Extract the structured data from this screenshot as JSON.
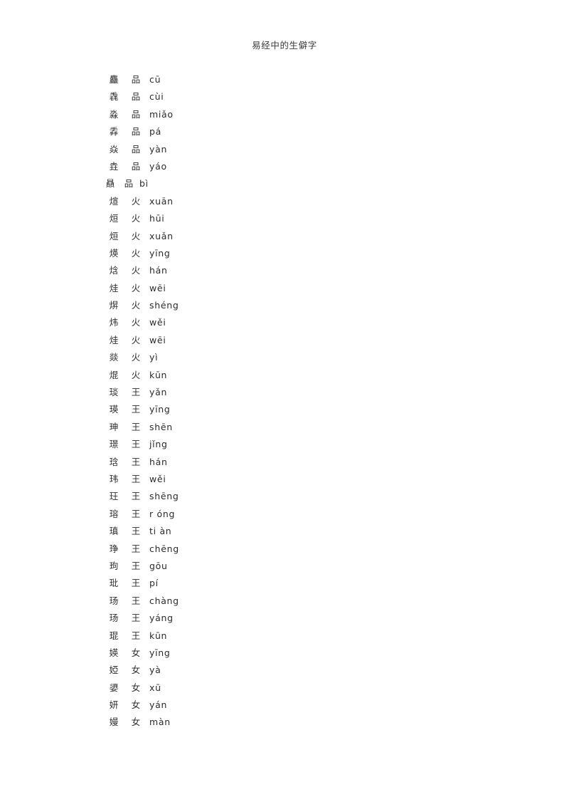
{
  "document": {
    "title": "易经中的生僻字"
  },
  "entries": [
    {
      "character": "麤",
      "radical": "品",
      "pinyin": "cū",
      "compact": false
    },
    {
      "character": "毳",
      "radical": "品",
      "pinyin": "cùi",
      "compact": false
    },
    {
      "character": "淼",
      "radical": "品",
      "pinyin": "miǎo",
      "compact": false
    },
    {
      "character": "掱",
      "radical": "品",
      "pinyin": "pá",
      "compact": false
    },
    {
      "character": "焱",
      "radical": "品",
      "pinyin": "yàn",
      "compact": false
    },
    {
      "character": "垚",
      "radical": "品",
      "pinyin": "yáo",
      "compact": false
    },
    {
      "character": "贔",
      "radical": "品",
      "pinyin": "bì",
      "compact": true
    },
    {
      "character": "煊",
      "radical": "火",
      "pinyin": "xuān",
      "compact": false
    },
    {
      "character": "烜",
      "radical": "火",
      "pinyin": "hūi",
      "compact": false
    },
    {
      "character": "烜",
      "radical": "火",
      "pinyin": "xuǎn",
      "compact": false
    },
    {
      "character": "煐",
      "radical": "火",
      "pinyin": "yīng",
      "compact": false
    },
    {
      "character": "焓",
      "radical": "火",
      "pinyin": "hán",
      "compact": false
    },
    {
      "character": "烓",
      "radical": "火",
      "pinyin": "wēi",
      "compact": false
    },
    {
      "character": "焺",
      "radical": "火",
      "pinyin": "shéng",
      "compact": false
    },
    {
      "character": "炜",
      "radical": "火",
      "pinyin": "wěi",
      "compact": false
    },
    {
      "character": "烓",
      "radical": "火",
      "pinyin": "wēi",
      "compact": false
    },
    {
      "character": "燚",
      "radical": "火",
      "pinyin": "yì",
      "compact": false
    },
    {
      "character": "焜",
      "radical": "火",
      "pinyin": "kūn",
      "compact": false
    },
    {
      "character": "琰",
      "radical": "王",
      "pinyin": "yǎn",
      "compact": false
    },
    {
      "character": "瑛",
      "radical": "王",
      "pinyin": "yīng",
      "compact": false
    },
    {
      "character": "珅",
      "radical": "王",
      "pinyin": "shēn",
      "compact": false
    },
    {
      "character": "璟",
      "radical": "王",
      "pinyin": "jǐng",
      "compact": false
    },
    {
      "character": "琀",
      "radical": "王",
      "pinyin": "hán",
      "compact": false
    },
    {
      "character": "玮",
      "radical": "王",
      "pinyin": "wěi",
      "compact": false
    },
    {
      "character": "玨",
      "radical": "王",
      "pinyin": "shēng",
      "compact": false
    },
    {
      "character": "瑢",
      "radical": "王",
      "pinyin": "r óng",
      "compact": false
    },
    {
      "character": "瑱",
      "radical": "王",
      "pinyin": "ti àn",
      "compact": false
    },
    {
      "character": "琤",
      "radical": "王",
      "pinyin": "chēng",
      "compact": false
    },
    {
      "character": "玽",
      "radical": "王",
      "pinyin": "gōu",
      "compact": false
    },
    {
      "character": "玭",
      "radical": "王",
      "pinyin": "pí",
      "compact": false
    },
    {
      "character": "玚",
      "radical": "王",
      "pinyin": "chàng",
      "compact": false
    },
    {
      "character": "玚",
      "radical": "王",
      "pinyin": "yáng",
      "compact": false
    },
    {
      "character": "琨",
      "radical": "王",
      "pinyin": "kūn",
      "compact": false
    },
    {
      "character": "媖",
      "radical": "女",
      "pinyin": "yīng",
      "compact": false
    },
    {
      "character": "婭",
      "radical": "女",
      "pinyin": "yà",
      "compact": false
    },
    {
      "character": "嬃",
      "radical": "女",
      "pinyin": "xū",
      "compact": false
    },
    {
      "character": "妍",
      "radical": "女",
      "pinyin": "yán",
      "compact": false
    },
    {
      "character": "嫚",
      "radical": "女",
      "pinyin": "màn",
      "compact": false
    }
  ]
}
